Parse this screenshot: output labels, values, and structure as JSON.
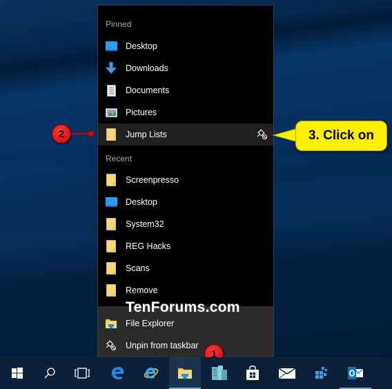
{
  "jumplist": {
    "pinned_title": "Pinned",
    "pinned": [
      {
        "label": "Desktop",
        "icon": "desktop-icon"
      },
      {
        "label": "Downloads",
        "icon": "downloads-icon"
      },
      {
        "label": "Documents",
        "icon": "documents-icon"
      },
      {
        "label": "Pictures",
        "icon": "pictures-icon"
      },
      {
        "label": "Jump Lists",
        "icon": "folder-icon",
        "selected": true,
        "action_icon": "unpin-icon"
      }
    ],
    "recent_title": "Recent",
    "recent": [
      {
        "label": "Screenpresso",
        "icon": "folder-icon"
      },
      {
        "label": "Desktop",
        "icon": "desktop-icon"
      },
      {
        "label": "System32",
        "icon": "folder-icon"
      },
      {
        "label": "REG Hacks",
        "icon": "folder-icon"
      },
      {
        "label": "Scans",
        "icon": "folder-icon"
      },
      {
        "label": "Remove",
        "icon": "folder-icon"
      }
    ],
    "footer": [
      {
        "label": "File Explorer",
        "icon": "file-explorer-icon"
      },
      {
        "label": "Unpin from taskbar",
        "icon": "unpin-icon"
      }
    ]
  },
  "watermark": "TenForums.com",
  "annotations": {
    "badge1": "1",
    "badge2": "2",
    "callout": "3. Click on",
    "badge_color": "#e00000",
    "callout_color": "#ffef00"
  },
  "taskbar": {
    "items": [
      {
        "name": "start-button",
        "icon": "windows-logo-icon"
      },
      {
        "name": "search-button",
        "icon": "search-icon"
      },
      {
        "name": "task-view-button",
        "icon": "task-view-icon"
      },
      {
        "name": "edge-button",
        "icon": "edge-icon"
      },
      {
        "name": "internet-explorer-button",
        "icon": "internet-explorer-icon"
      },
      {
        "name": "file-explorer-button",
        "icon": "file-explorer-icon",
        "active": true
      },
      {
        "name": "server-manager-button",
        "icon": "server-manager-icon"
      },
      {
        "name": "store-button",
        "icon": "store-icon"
      },
      {
        "name": "mail-button",
        "icon": "mail-icon"
      },
      {
        "name": "hyper-v-button",
        "icon": "hyper-v-icon"
      },
      {
        "name": "outlook-button",
        "icon": "outlook-icon"
      }
    ]
  }
}
